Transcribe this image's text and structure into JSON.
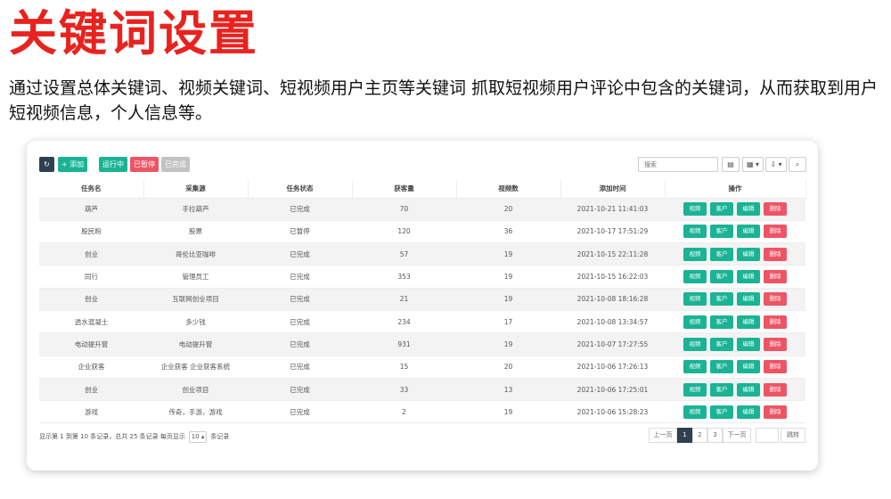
{
  "headline": "关键词设置",
  "description": "通过设置总体关键词、视频关键词、短视频用户主页等关键词 抓取短视频用户评论中包含的关键词，从而获取到用户短视频信息，个人信息等。",
  "toolbar": {
    "refresh_icon": "refresh-icon",
    "add_label": "+ 添加",
    "running_label": "运行中",
    "paused_label": "已暂停",
    "done_label": "已完成",
    "search_placeholder": "搜索",
    "card_view_icon": "▤",
    "columns_icon": "▦ ▾",
    "export_icon": "⇩ ▾",
    "search_icon": "⌕"
  },
  "table": {
    "headers": [
      "任务名",
      "采集源",
      "任务状态",
      "获客量",
      "视频数",
      "添加时间",
      "操作"
    ],
    "rows": [
      {
        "name": "葫芦",
        "source": "手拉葫芦",
        "status": "已完成",
        "leads": "70",
        "videos": "20",
        "time": "2021-10-21 11:41:03"
      },
      {
        "name": "股民粉",
        "source": "股票",
        "status": "已暂停",
        "leads": "120",
        "videos": "36",
        "time": "2021-10-17 17:51:29"
      },
      {
        "name": "创业",
        "source": "哥伦比亚咖啡",
        "status": "已完成",
        "leads": "57",
        "videos": "19",
        "time": "2021-10-15 22:11:28"
      },
      {
        "name": "同行",
        "source": "管理员工",
        "status": "已完成",
        "leads": "353",
        "videos": "19",
        "time": "2021-10-15 16:22:03"
      },
      {
        "name": "创业",
        "source": "互联网创业项目",
        "status": "已完成",
        "leads": "21",
        "videos": "19",
        "time": "2021-10-08 18:16:28"
      },
      {
        "name": "透水混凝土",
        "source": "多少钱",
        "status": "已完成",
        "leads": "234",
        "videos": "17",
        "time": "2021-10-08 13:34:57"
      },
      {
        "name": "电动提升窗",
        "source": "电动提升窗",
        "status": "已完成",
        "leads": "931",
        "videos": "19",
        "time": "2021-10-07 17:27:55"
      },
      {
        "name": "企业获客",
        "source": "企业获客 企业获客系统",
        "status": "已完成",
        "leads": "15",
        "videos": "20",
        "time": "2021-10-06 17:26:13"
      },
      {
        "name": "创业",
        "source": "创业项目",
        "status": "已完成",
        "leads": "33",
        "videos": "13",
        "time": "2021-10-06 17:25:01"
      },
      {
        "name": "游戏",
        "source": "传奇，手游，游戏",
        "status": "已完成",
        "leads": "2",
        "videos": "19",
        "time": "2021-10-06 15:28:23"
      }
    ],
    "actions": {
      "video": "视频",
      "customer": "客户",
      "edit": "编辑",
      "delete": "删除"
    }
  },
  "footer": {
    "summary_before": "显示第 1 到第 10 条记录，总共 25 条记录 每页显示",
    "page_size": "10 ▴",
    "summary_after": "条记录",
    "prev": "上一页",
    "pages": [
      "1",
      "2",
      "3"
    ],
    "next": "下一页",
    "jump": "跳转"
  },
  "colors": {
    "headline": "#e8231f",
    "primary": "#1ab394",
    "danger": "#ed5565",
    "dark": "#2f4050",
    "muted": "#c2c2c2"
  }
}
